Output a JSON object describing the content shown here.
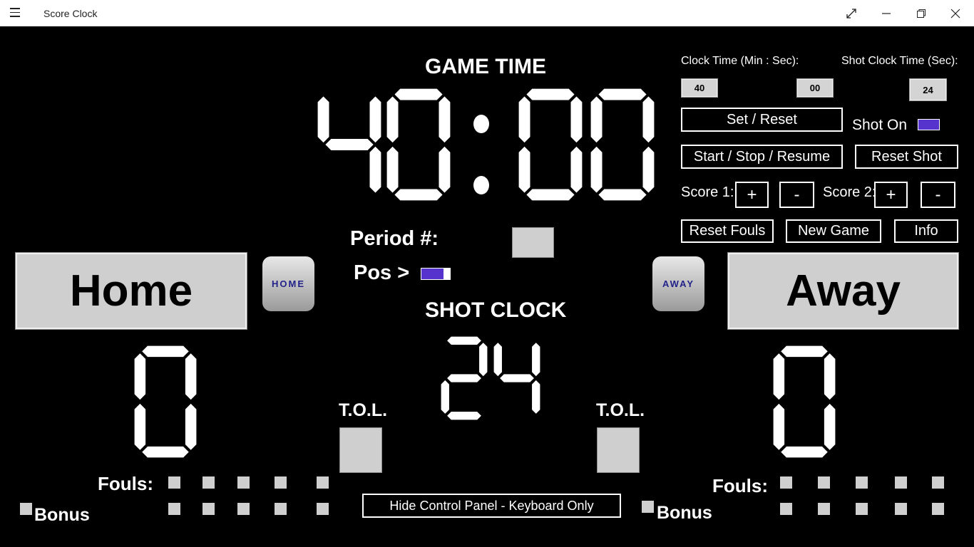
{
  "app": {
    "title": "Score Clock"
  },
  "colors": {
    "accent": "#5533cc",
    "panel": "#cfcfcf",
    "background": "#000000"
  },
  "game_time": {
    "label": "GAME TIME",
    "minutes": "40",
    "seconds": "00"
  },
  "shot_clock": {
    "label": "SHOT CLOCK",
    "value": "24"
  },
  "period": {
    "label": "Period #:",
    "value": ""
  },
  "possession": {
    "label": "Pos >"
  },
  "home": {
    "name": "Home",
    "logo": "HOME",
    "score": "0",
    "tol_label": "T.O.L.",
    "fouls_label": "Fouls:",
    "bonus_label": "Bonus"
  },
  "away": {
    "name": "Away",
    "logo": "AWAY",
    "score": "0",
    "tol_label": "T.O.L.",
    "fouls_label": "Fouls:",
    "bonus_label": "Bonus"
  },
  "controls": {
    "clock_time_label": "Clock Time (Min : Sec):",
    "clock_min": "40",
    "clock_sec": "00",
    "shot_clock_time_label": "Shot Clock Time (Sec):",
    "shot_sec": "24",
    "set_reset": "Set / Reset",
    "shot_on": "Shot On",
    "start_stop": "Start / Stop / Resume",
    "reset_shot": "Reset Shot",
    "score1_label": "Score 1:",
    "score2_label": "Score 2:",
    "plus": "+",
    "minus": "-",
    "reset_fouls": "Reset Fouls",
    "new_game": "New Game",
    "info": "Info",
    "hide_panel": "Hide Control Panel - Keyboard Only"
  },
  "icons": {
    "menu": "hamburger-icon",
    "fullscreen": "expand-icon",
    "minimize": "minimize-icon",
    "restore": "restore-icon",
    "close": "close-icon"
  }
}
